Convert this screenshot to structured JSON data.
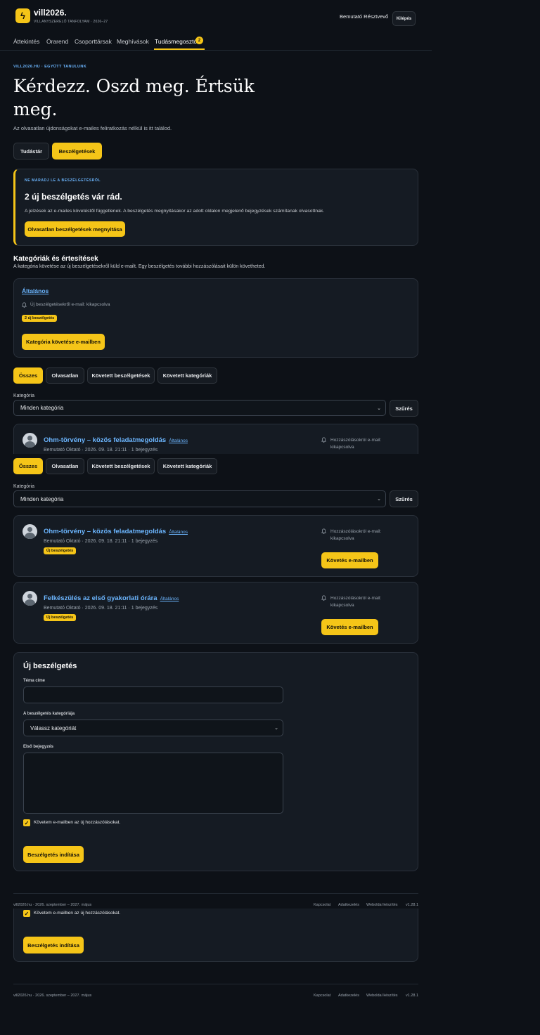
{
  "header": {
    "brand": "vill2026.",
    "subtitle": "VILLANYSZERELŐ TANFOLYAM · 2026–27",
    "user_name": "Bemutató Résztvevő",
    "logout_label": "Kilépés"
  },
  "nav": {
    "tabs": [
      {
        "label": "Áttekintés"
      },
      {
        "label": "Órarend"
      },
      {
        "label": "Csoporttársak"
      },
      {
        "label": "Meghívások"
      },
      {
        "label": "Tudásmegosztó",
        "badge": "2"
      }
    ]
  },
  "hero": {
    "eyebrow": "VILL2026.HU · EGYÜTT TANULUNK",
    "title_line1": "Kérdezz. Oszd meg. Értsük",
    "title_line2": "meg.",
    "lead": "Az olvasatlan újdonságokat e-mailes feliratkozás nélkül is itt találod.",
    "btn_knowledge": "Tudástár",
    "btn_discussions": "Beszélgetések"
  },
  "notice": {
    "eyebrow": "NE MARADJ LE A BESZÉLGETÉSRŐL",
    "title": "2 új beszélgetés vár rád.",
    "text": "A jelzések az e-mailes követéstől függetlenek. A beszélgetés megnyitásakor az adott oldalon megjelenő bejegyzések számítanak olvasottnak.",
    "button": "Olvasatlan beszélgetések megnyitása"
  },
  "categories": {
    "title": "Kategóriák és értesítések",
    "desc": "A kategória követése az új beszélgetésekről küld e-mailt. Egy beszélgetés további hozzászólásait külön követheted.",
    "item": {
      "name": "Általános",
      "notify": "Új beszélgetésekről e-mail: kikapcsolva",
      "badge": "2 új beszélgetés",
      "button": "Kategória követése e-mailben"
    }
  },
  "filters": {
    "tabs": [
      "Összes",
      "Olvasatlan",
      "Követett beszélgetések",
      "Követett kategóriák"
    ],
    "category_label": "Kategória",
    "category_value": "Minden kategória",
    "filter_button": "Szűrés"
  },
  "topics": [
    {
      "title": "Ohm-törvény – közös feladatmegoldás",
      "category": "Általános",
      "meta": "Bemutató Oktató · 2026. 09. 18. 21:11 · 1 bejegyzés",
      "badge": "Új beszélgetés",
      "notify_line1": "Hozzászólásokról e-mail:",
      "notify_line2": "kikapcsolva",
      "button": "Követés e-mailben"
    },
    {
      "title": "Felkészülés az első gyakorlati órára",
      "category": "Általános",
      "meta": "Bemutató Oktató · 2026. 09. 18. 21:11 · 1 bejegyzés",
      "badge": "Új beszélgetés",
      "notify_line1": "Hozzászólásokról e-mail:",
      "notify_line2": "kikapcsolva",
      "button": "Követés e-mailben"
    }
  ],
  "new_topic": {
    "title": "Új beszélgetés",
    "label_title": "Téma címe",
    "label_category": "A beszélgetés kategóriája",
    "category_placeholder": "Válassz kategóriát",
    "label_first_post": "Első bejegyzés",
    "follow_label": "Követem e-mailben az új hozzászólásokat.",
    "submit": "Beszélgetés indítása"
  },
  "footer": {
    "left": "vill2026.hu · 2026. szeptember – 2027. május",
    "links": [
      "Kapcsolat",
      "Adatkezelés",
      "Weboldal készítés"
    ],
    "version": "v1.28.1"
  },
  "colors": {
    "accent": "#f5c518",
    "link": "#6cb6ff",
    "bg": "#0d1117",
    "card": "#151b23"
  }
}
